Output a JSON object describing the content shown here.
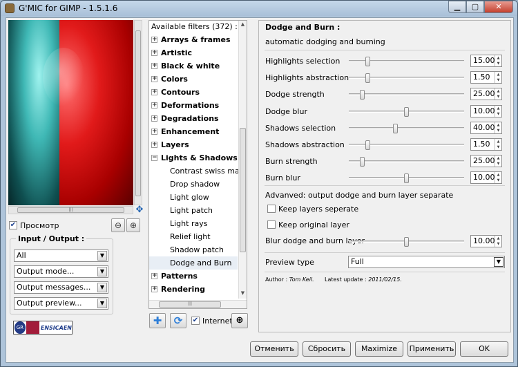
{
  "window": {
    "title": "G'MIC for GIMP - 1.5.1.6"
  },
  "preview": {
    "checkbox_label": "Просмотр",
    "checked": true,
    "io_title": "Input / Output :",
    "input_value": "All",
    "output_mode": "Output mode...",
    "output_messages": "Output messages...",
    "output_preview": "Output preview...",
    "logo_text": "ENSICAEN",
    "logo_mark": "GR",
    "hscroll_grip": "|||"
  },
  "filters": {
    "header": "Available filters (372) :",
    "items": [
      {
        "label": "Arrays & frames",
        "type": "cat",
        "exp": "+"
      },
      {
        "label": "Artistic",
        "type": "cat",
        "exp": "+"
      },
      {
        "label": "Black & white",
        "type": "cat",
        "exp": "+"
      },
      {
        "label": "Colors",
        "type": "cat",
        "exp": "+"
      },
      {
        "label": "Contours",
        "type": "cat",
        "exp": "+"
      },
      {
        "label": "Deformations",
        "type": "cat",
        "exp": "+"
      },
      {
        "label": "Degradations",
        "type": "cat",
        "exp": "+"
      },
      {
        "label": "Enhancement",
        "type": "cat",
        "exp": "+"
      },
      {
        "label": "Layers",
        "type": "cat",
        "exp": "+"
      },
      {
        "label": "Lights & Shadows",
        "type": "cat",
        "exp": "−"
      },
      {
        "label": "Contrast swiss mask",
        "type": "child"
      },
      {
        "label": "Drop shadow",
        "type": "child"
      },
      {
        "label": "Light glow",
        "type": "child"
      },
      {
        "label": "Light patch",
        "type": "child"
      },
      {
        "label": "Light rays",
        "type": "child"
      },
      {
        "label": "Relief light",
        "type": "child"
      },
      {
        "label": "Shadow patch",
        "type": "child"
      },
      {
        "label": "Dodge and Burn",
        "type": "child",
        "selected": true
      },
      {
        "label": "Patterns",
        "type": "cat",
        "exp": "+"
      },
      {
        "label": "Rendering",
        "type": "cat",
        "exp": "+"
      }
    ],
    "internet_label": "Internet",
    "internet_checked": true,
    "hscroll_grip": "|||"
  },
  "params": {
    "title": "Dodge and Burn :",
    "description": "automatic dodging and burning",
    "sliders": [
      {
        "label": "Highlights selection",
        "value": "15.00",
        "pos": 0.15
      },
      {
        "label": "Highlights abstraction",
        "value": "1.50",
        "pos": 0.15
      },
      {
        "label": "Dodge strength",
        "value": "25.00",
        "pos": 0.1
      },
      {
        "label": "Dodge blur",
        "value": "10.00",
        "pos": 0.5
      },
      {
        "label": "Shadows selection",
        "value": "40.00",
        "pos": 0.4
      },
      {
        "label": "Shadows abstraction",
        "value": "1.50",
        "pos": 0.15
      },
      {
        "label": "Burn strength",
        "value": "25.00",
        "pos": 0.1
      },
      {
        "label": "Burn blur",
        "value": "10.00",
        "pos": 0.5
      }
    ],
    "advanced_label": "Advanved: output dodge and burn layer separate",
    "keep_separate": "Keep layers seperate",
    "keep_original": "Keep original layer",
    "blur_label": "Blur dodge and burn layer",
    "blur_value": "10.00",
    "blur_pos": 0.5,
    "preview_type_label": "Preview type",
    "preview_type_value": "Full",
    "author_prefix": "Author :",
    "author": "Tom Keil.",
    "update_prefix": "Latest update :",
    "update": "2011/02/15."
  },
  "buttons": {
    "cancel": "Отменить",
    "reset": "Сбросить",
    "maximize": "Maximize",
    "apply": "Применить",
    "ok": "OK"
  }
}
